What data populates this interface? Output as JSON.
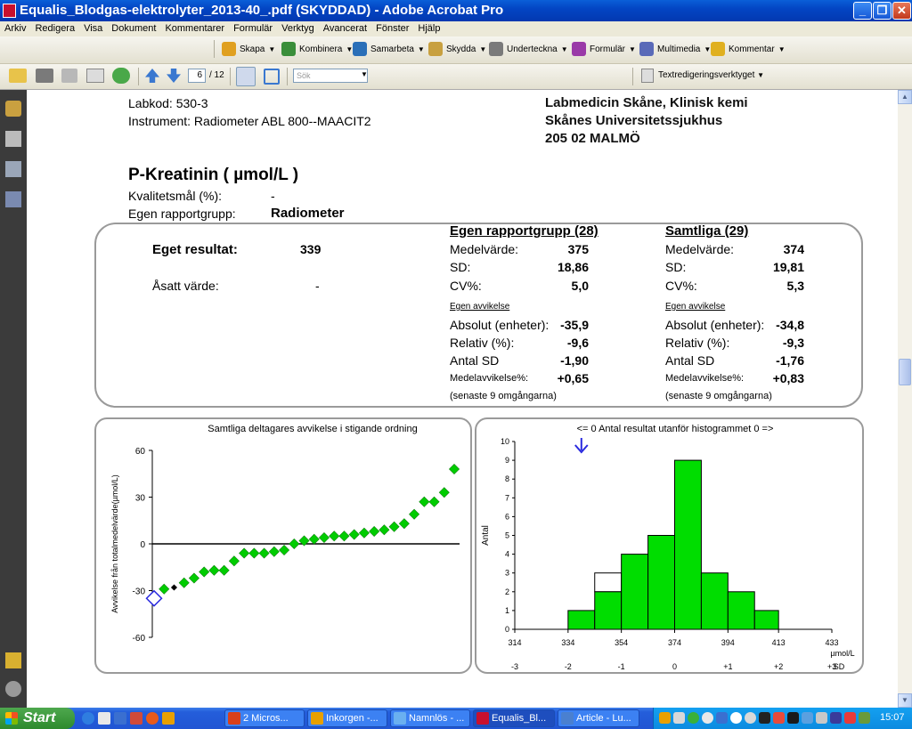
{
  "window": {
    "title": "Equalis_Blodgas-elektrolyter_2013-40_.pdf (SKYDDAD) - Adobe Acrobat Pro",
    "minimize": "_",
    "restore": "❐",
    "close": "✕"
  },
  "menu": [
    "Arkiv",
    "Redigera",
    "Visa",
    "Dokument",
    "Kommentarer",
    "Formulär",
    "Verktyg",
    "Avancerat",
    "Fönster",
    "Hjälp"
  ],
  "toolbar1": {
    "items": [
      {
        "label": "Skapa",
        "color": "#e0a020",
        "icon": "create-pdf-icon"
      },
      {
        "label": "Kombinera",
        "color": "#3a8e3a",
        "icon": "combine-icon"
      },
      {
        "label": "Samarbeta",
        "color": "#2a6fb8",
        "icon": "collaborate-icon"
      },
      {
        "label": "Skydda",
        "color": "#c8a040",
        "icon": "lock-icon"
      },
      {
        "label": "Underteckna",
        "color": "#7a7a7a",
        "icon": "pen-icon"
      },
      {
        "label": "Formulär",
        "color": "#9a3aa8",
        "icon": "form-icon"
      },
      {
        "label": "Multimedia",
        "color": "#5a6ab8",
        "icon": "film-icon"
      },
      {
        "label": "Kommentar",
        "color": "#e0b020",
        "icon": "comment-icon"
      }
    ]
  },
  "toolbar2": {
    "page_current": "6",
    "page_total": "/ 12",
    "search_placeholder": "Sök",
    "text_edit_tools": "Textredigeringsverktyget"
  },
  "doc": {
    "labkod": "Labkod: 530-3",
    "instrument": "Instrument: Radiometer ABL 800--MAACIT2",
    "lab_name": "Labmedicin Skåne, Klinisk kemi",
    "hospital": "Skånes Universitetssjukhus",
    "postal": "205 02 MALMÖ",
    "analyte_title": "P-Kreatinin ( µmol/L )",
    "quality_goal_label": "Kvalitetsmål (%):",
    "quality_goal_value": "-",
    "report_group_label": "Egen rapportgrupp:",
    "report_group_value": "Radiometer",
    "own_result_label": "Eget resultat:",
    "own_result_value": "339",
    "assigned_label": "Åsatt värde:",
    "assigned_value": "-",
    "group_header": "Egen rapportgrupp  (28)",
    "all_header": "Samtliga  (29)",
    "deviation_header": "Egen avvikelse",
    "recent_note": "(senaste 9 omgångarna)",
    "stat_labels": [
      "Medelvärde:",
      "SD:",
      "CV%:"
    ],
    "group_stats": [
      "375",
      "18,86",
      "5,0"
    ],
    "all_stats": [
      "374",
      "19,81",
      "5,3"
    ],
    "dev_labels": [
      "Absolut (enheter):",
      "Relativ (%):",
      "Antal SD",
      "Medelavvikelse%:"
    ],
    "group_dev": [
      "-35,9",
      "-9,6",
      "-1,90",
      "+0,65"
    ],
    "all_dev": [
      "-34,8",
      "-9,3",
      "-1,76",
      "+0,83"
    ]
  },
  "chart_data": [
    {
      "type": "scatter",
      "title": "Samtliga deltagares avvikelse i stigande ordning",
      "ylabel": "Avvikelse från totalmedelvärde(µmol/L)",
      "ylim": [
        -60,
        60
      ],
      "yticks": [
        60,
        30,
        0,
        -30,
        -60
      ],
      "own_index": 0,
      "own_color": "#2a2adf",
      "point_color": "#00cc00",
      "values": [
        -35,
        -29,
        -28,
        -25,
        -22,
        -18,
        -17,
        -17,
        -11,
        -6,
        -6,
        -6,
        -5,
        -4,
        0,
        2,
        3,
        4,
        5,
        5,
        6,
        7,
        8,
        9,
        11,
        13,
        19,
        27,
        27,
        33,
        48
      ]
    },
    {
      "type": "bar",
      "title": "<= 0 Antal resultat utanför histogrammet 0 =>",
      "ylabel": "Antal",
      "xunit": "µmol/L",
      "sdunit": "SD",
      "ylim": [
        0,
        10
      ],
      "yticks": [
        10,
        9,
        8,
        7,
        6,
        5,
        4,
        3,
        2,
        1,
        0
      ],
      "x_ticks": [
        "314",
        "334",
        "354",
        "374",
        "394",
        "413",
        "433"
      ],
      "sd_ticks": [
        "-3",
        "-2",
        "-1",
        "0",
        "+1",
        "+2",
        "+3"
      ],
      "bin_edges": [
        334,
        344,
        354,
        364,
        374,
        384,
        394,
        404,
        413
      ],
      "values": [
        1,
        3,
        4,
        5,
        9,
        3,
        2,
        1,
        1
      ],
      "group_values": [
        1,
        2,
        4,
        5,
        9,
        3,
        2,
        1,
        1
      ],
      "bar_color": "#00dd00",
      "own_marker_x": 339,
      "own_marker_color": "#2a2adf"
    }
  ],
  "taskbar": {
    "start": "Start",
    "clock": "15:07",
    "items": [
      {
        "label": "2 Micros...",
        "color": "#d9401a",
        "icon": "powerpoint-icon"
      },
      {
        "label": "Inkorgen -...",
        "color": "#e8a000",
        "icon": "outlook-icon"
      },
      {
        "label": "Namnlös - ...",
        "color": "#6ab0f0",
        "icon": "paint-icon"
      },
      {
        "label": "Equalis_Bl...",
        "color": "#c8102e",
        "icon": "acrobat-icon"
      },
      {
        "label": "Article - Lu...",
        "color": "#4a80d0",
        "icon": "browser-icon"
      }
    ]
  }
}
